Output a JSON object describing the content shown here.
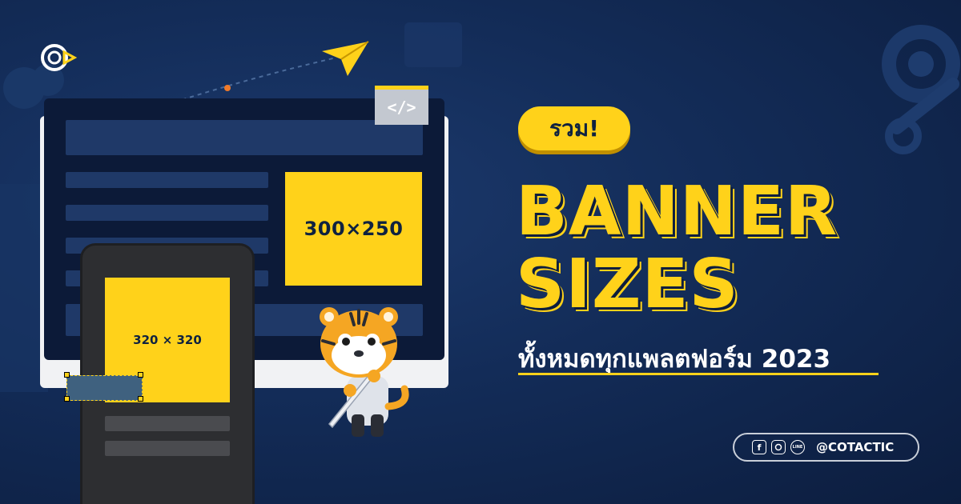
{
  "brand": {
    "logo_icon": "cotactic-logo-icon"
  },
  "desktop_ad": {
    "label": "300×250"
  },
  "code_tag": {
    "label": "</>"
  },
  "mobile_ad": {
    "label": "320 × 320"
  },
  "headline": {
    "badge": "รวม!",
    "line1": "BANNER",
    "line2": "SIZES",
    "subtitle": "ทั้งหมดทุกแพลตฟอร์ม 2023"
  },
  "social": {
    "icons": [
      "facebook-icon",
      "instagram-icon",
      "line-icon"
    ],
    "handle": "@COTACTIC"
  },
  "colors": {
    "background": "#132c58",
    "accent": "#ffd21a",
    "text": "#ffffff"
  }
}
